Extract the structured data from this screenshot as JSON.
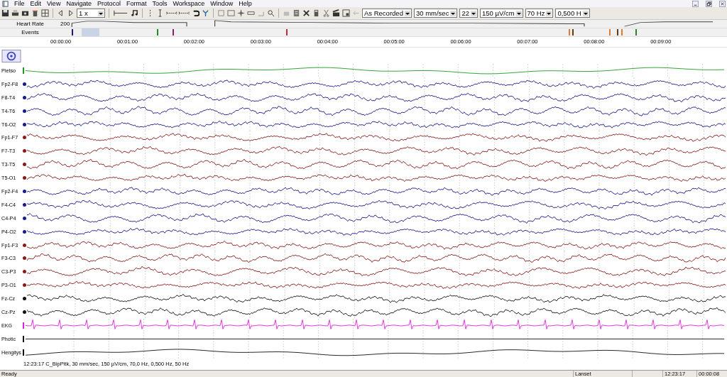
{
  "menu": [
    "File",
    "Edit",
    "View",
    "Navigate",
    "Protocol",
    "Format",
    "Tools",
    "Workspace",
    "Window",
    "Help"
  ],
  "toolbar": {
    "speed": "1 x",
    "dropdowns": [
      "As Recorded",
      "30 mm/sec",
      "22",
      "150 µV/cm",
      "70 Hz",
      "0,500 H"
    ]
  },
  "heart_rate": {
    "label": "Heart Rate",
    "value": "200"
  },
  "events": {
    "label": "Events",
    "marks": [
      {
        "color": "#1a1a7a"
      },
      {
        "color": "#1f8a2a"
      },
      {
        "color": "#8a1a7a"
      },
      {
        "color": "#cc2a2a"
      },
      {
        "color": "#e07a30"
      },
      {
        "color": "#6a3a10"
      },
      {
        "color": "#e07a30"
      },
      {
        "color": "#6a3a10"
      },
      {
        "color": "#e07a30"
      },
      {
        "color": "#1f8a2a"
      }
    ]
  },
  "time_axis": [
    "00:00:00",
    "00:01:00",
    "00:02:00",
    "00:03:00",
    "00:04:00",
    "00:05:00",
    "00:06:00",
    "00:07:00",
    "00:08:00",
    "00:09:00"
  ],
  "channels": [
    {
      "label": "Pietso",
      "kind": "slow",
      "color": "#1f9a1f"
    },
    {
      "label": "Fp2-F8",
      "kind": "eeg",
      "color": "#1a1a8a"
    },
    {
      "label": "F8-T4",
      "kind": "eeg",
      "color": "#1a1a8a"
    },
    {
      "label": "T4-T6",
      "kind": "eeg",
      "color": "#1a1a8a"
    },
    {
      "label": "T6-O2",
      "kind": "eeg",
      "color": "#1a1a8a"
    },
    {
      "label": "Fp1-F7",
      "kind": "eeg",
      "color": "#8a1a1a"
    },
    {
      "label": "F7-T3",
      "kind": "eeg",
      "color": "#8a1a1a"
    },
    {
      "label": "T3-T5",
      "kind": "eeg",
      "color": "#8a1a1a"
    },
    {
      "label": "T5-O1",
      "kind": "eeg",
      "color": "#8a1a1a"
    },
    {
      "label": "Fp2-F4",
      "kind": "eeg",
      "color": "#1a1a8a"
    },
    {
      "label": "F4-C4",
      "kind": "eeg",
      "color": "#1a1a8a"
    },
    {
      "label": "C4-P4",
      "kind": "eeg",
      "color": "#1a1a8a"
    },
    {
      "label": "P4-O2",
      "kind": "eeg",
      "color": "#1a1a8a"
    },
    {
      "label": "Fp1-F3",
      "kind": "eeg",
      "color": "#8a1a1a"
    },
    {
      "label": "F3-C3",
      "kind": "eeg",
      "color": "#8a1a1a"
    },
    {
      "label": "C3-P3",
      "kind": "eeg",
      "color": "#8a1a1a"
    },
    {
      "label": "P3-O1",
      "kind": "eeg",
      "color": "#8a1a1a"
    },
    {
      "label": "Fz-Cz",
      "kind": "eeg",
      "color": "#111111"
    },
    {
      "label": "Cz-Pz",
      "kind": "eeg",
      "color": "#111111"
    },
    {
      "label": "EKG",
      "kind": "ecg",
      "color": "#e020e0"
    },
    {
      "label": "Photic",
      "kind": "flat",
      "color": "#111111"
    },
    {
      "label": "Hengitys",
      "kind": "slow",
      "color": "#111111"
    }
  ],
  "footer": "12:23:17 C_BipPitk, 30 mm/sec, 150 µV/cm, 70,0 Hz, 0,500 Hz, 50 Hz",
  "status_bar": [
    "Ready",
    "Lanset",
    "12:23:17",
    "00:00:08"
  ]
}
